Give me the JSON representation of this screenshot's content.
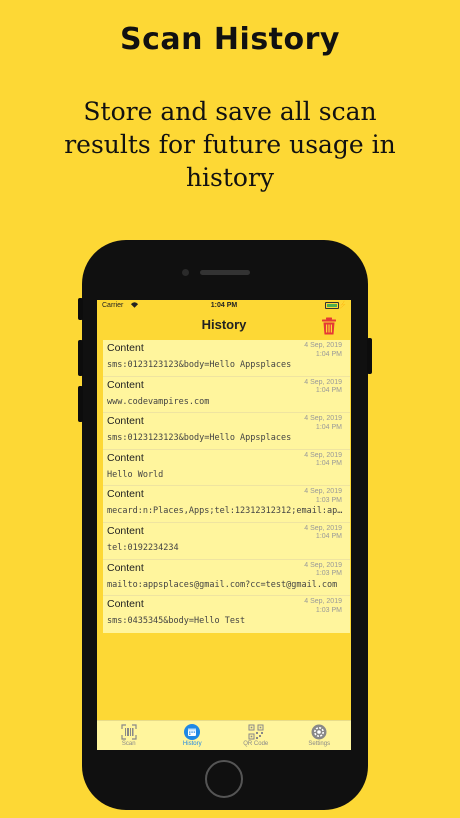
{
  "promo": {
    "title": "Scan History",
    "subtitle": "Store and save all scan results for future usage in history"
  },
  "status_bar": {
    "carrier": "Carrier",
    "time": "1:04 PM"
  },
  "nav": {
    "title": "History",
    "trash_icon": "trash-icon"
  },
  "history": [
    {
      "title": "Content",
      "date": "4 Sep, 2019",
      "time": "1:04 PM",
      "content": "sms:0123123123&body=Hello Appsplaces"
    },
    {
      "title": "Content",
      "date": "4 Sep, 2019",
      "time": "1:04 PM",
      "content": "www.codevampires.com"
    },
    {
      "title": "Content",
      "date": "4 Sep, 2019",
      "time": "1:04 PM",
      "content": "sms:0123123123&body=Hello Appsplaces"
    },
    {
      "title": "Content",
      "date": "4 Sep, 2019",
      "time": "1:04 PM",
      "content": "Hello World"
    },
    {
      "title": "Content",
      "date": "4 Sep, 2019",
      "time": "1:03 PM",
      "content": "mecard:n:Places,Apps;tel:12312312312;email:ap..."
    },
    {
      "title": "Content",
      "date": "4 Sep, 2019",
      "time": "1:04 PM",
      "content": "tel:0192234234"
    },
    {
      "title": "Content",
      "date": "4 Sep, 2019",
      "time": "1:03 PM",
      "content": "mailto:appsplaces@gmail.com?cc=test@gmail.com"
    },
    {
      "title": "Content",
      "date": "4 Sep, 2019",
      "time": "1:03 PM",
      "content": "sms:0435345&body=Hello Test"
    }
  ],
  "tabs": [
    {
      "label": "Scan",
      "icon": "barcode-scan-icon",
      "active": false
    },
    {
      "label": "History",
      "icon": "calendar-icon",
      "active": true
    },
    {
      "label": "QR Code",
      "icon": "qr-code-icon",
      "active": false
    },
    {
      "label": "Settings",
      "icon": "gear-icon",
      "active": false
    }
  ],
  "colors": {
    "background": "#FDD835",
    "list_background": "#FFF59D",
    "accent": "#1E88E5",
    "trash": "#E53935"
  }
}
